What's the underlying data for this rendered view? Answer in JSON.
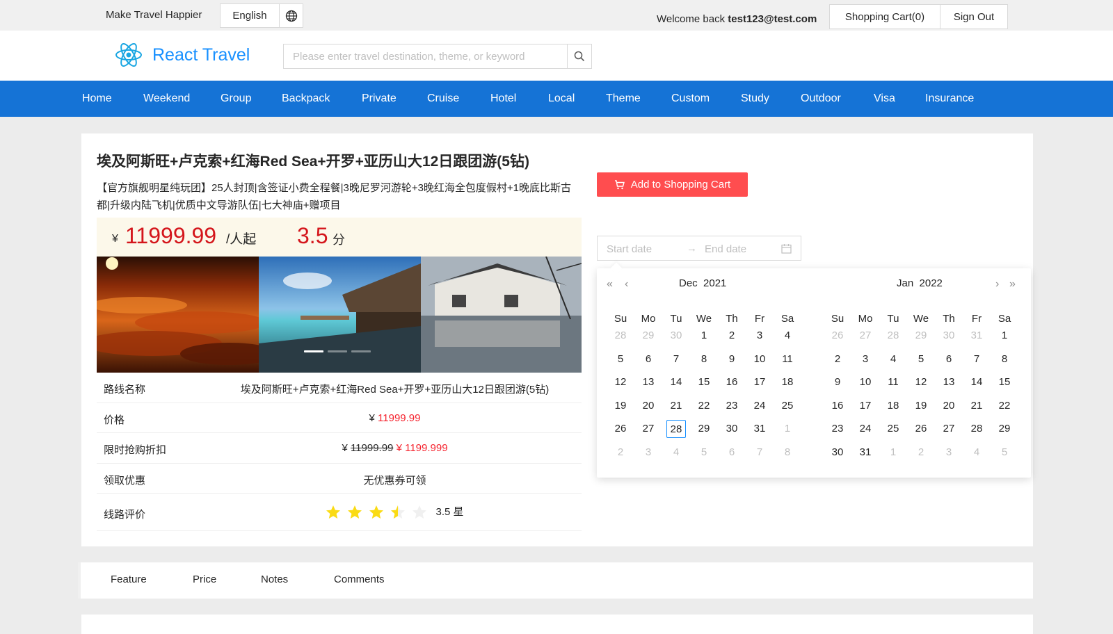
{
  "topbar": {
    "slogan": "Make Travel Happier",
    "language": "English",
    "welcome_prefix": "Welcome back",
    "username": "test123@test.com",
    "cart": "Shopping Cart(0)",
    "signout": "Sign Out"
  },
  "header": {
    "brand": "React Travel",
    "search_placeholder": "Please enter travel destination, theme, or keyword"
  },
  "nav": [
    "Home",
    "Weekend",
    "Group",
    "Backpack",
    "Private",
    "Cruise",
    "Hotel",
    "Local",
    "Theme",
    "Custom",
    "Study",
    "Outdoor",
    "Visa",
    "Insurance"
  ],
  "product": {
    "title": "埃及阿斯旺+卢克索+红海Red Sea+开罗+亚历山大12日跟团游(5钻)",
    "subtitle": "【官方旗舰明星纯玩团】25人封顶|含签证小费全程餐|3晚尼罗河游轮+3晚红海全包度假村+1晚底比斯古都|升级内陆飞机|优质中文导游队伍|七大神庙+赠项目",
    "currency": "¥",
    "price": "11999.99",
    "price_unit": "/人起",
    "score": "3.5",
    "score_unit": "分",
    "add_to_cart": "Add to Shopping Cart"
  },
  "table": {
    "route_label": "路线名称",
    "route_value": "埃及阿斯旺+卢克索+红海Red Sea+开罗+亚历山大12日跟团游(5钻)",
    "price_label": "价格",
    "price_currency": "¥",
    "price_value": "11999.99",
    "discount_label": "限时抢购折扣",
    "discount_currency": "¥",
    "discount_original": "11999.99",
    "discount_value": "¥ 1199.999",
    "coupon_label": "领取优惠",
    "coupon_value": "无优惠券可领",
    "rating_label": "线路评价",
    "rating_value": "3.5 星",
    "rating": 3.5
  },
  "datepicker": {
    "start_placeholder": "Start date",
    "end_placeholder": "End date",
    "arrow": "→",
    "left_month": "Dec",
    "left_year": "2021",
    "right_month": "Jan",
    "right_year": "2022",
    "weekdays": [
      "Su",
      "Mo",
      "Tu",
      "We",
      "Th",
      "Fr",
      "Sa"
    ],
    "left_days": [
      [
        "28",
        "29",
        "30",
        "1",
        "2",
        "3",
        "4"
      ],
      [
        "5",
        "6",
        "7",
        "8",
        "9",
        "10",
        "11"
      ],
      [
        "12",
        "13",
        "14",
        "15",
        "16",
        "17",
        "18"
      ],
      [
        "19",
        "20",
        "21",
        "22",
        "23",
        "24",
        "25"
      ],
      [
        "26",
        "27",
        "28",
        "29",
        "30",
        "31",
        "1"
      ],
      [
        "2",
        "3",
        "4",
        "5",
        "6",
        "7",
        "8"
      ]
    ],
    "right_days": [
      [
        "26",
        "27",
        "28",
        "29",
        "30",
        "31",
        "1"
      ],
      [
        "2",
        "3",
        "4",
        "5",
        "6",
        "7",
        "8"
      ],
      [
        "9",
        "10",
        "11",
        "12",
        "13",
        "14",
        "15"
      ],
      [
        "16",
        "17",
        "18",
        "19",
        "20",
        "21",
        "22"
      ],
      [
        "23",
        "24",
        "25",
        "26",
        "27",
        "28",
        "29"
      ],
      [
        "30",
        "31",
        "1",
        "2",
        "3",
        "4",
        "5"
      ]
    ],
    "today": "28"
  },
  "tabs": [
    "Feature",
    "Price",
    "Notes",
    "Comments"
  ],
  "colors": {
    "brand": "#1890ff",
    "nav": "#1573d6",
    "price": "#d4151b",
    "accent_red": "#ff4d4f",
    "star": "#fadb14"
  }
}
